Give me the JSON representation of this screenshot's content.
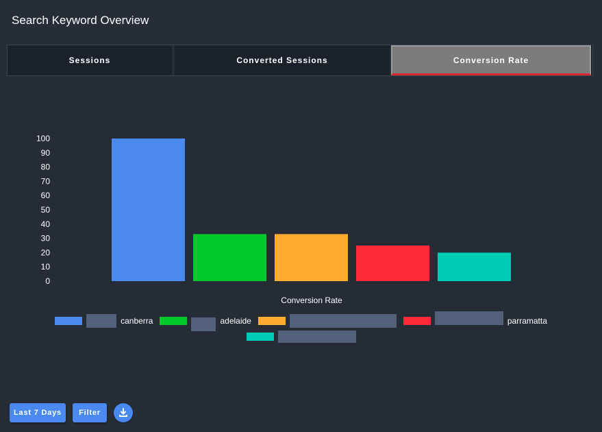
{
  "header": {
    "title": "Search Keyword Overview"
  },
  "tabs": [
    {
      "label": "Sessions",
      "active": false
    },
    {
      "label": "Converted Sessions",
      "active": false
    },
    {
      "label": "Conversion Rate",
      "active": true
    }
  ],
  "chart_data": {
    "type": "bar",
    "xlabel": "Conversion Rate",
    "ylabel": "",
    "ylim": [
      0,
      100
    ],
    "yticks": [
      0,
      10,
      20,
      30,
      40,
      50,
      60,
      70,
      80,
      90,
      100
    ],
    "grid": false,
    "legend_position": "bottom",
    "series": [
      {
        "name": "canberra",
        "value": 100,
        "color": "#4a89ee"
      },
      {
        "name": "adelaide",
        "value": 33,
        "color": "#00c82d"
      },
      {
        "name": "",
        "value": 33,
        "color": "#ffab2e"
      },
      {
        "name": "parramatta",
        "value": 25,
        "color": "#ff2a39"
      },
      {
        "name": "",
        "value": 20,
        "color": "#00cdb5"
      }
    ]
  },
  "footer": {
    "range_label": "Last 7 Days",
    "filter_label": "Filter",
    "download_icon": "download-icon"
  },
  "colors": {
    "accent": "#4a8af0",
    "active_tab_underline": "#d9262f"
  }
}
